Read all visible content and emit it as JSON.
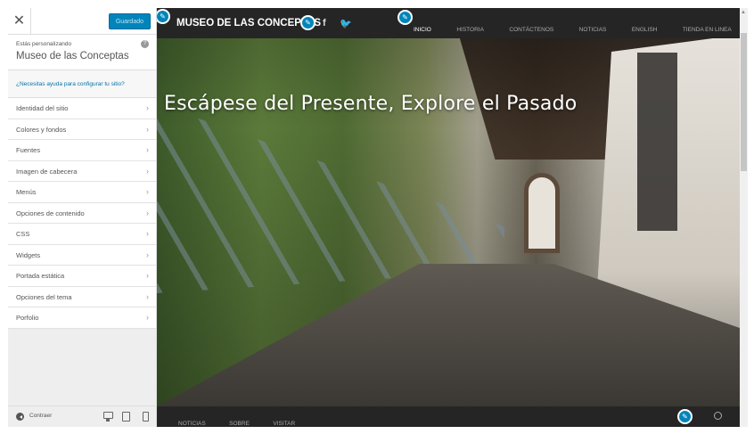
{
  "customizer": {
    "close_icon": "close-icon",
    "save_label": "Guardado",
    "editing_label": "Estás personalizando",
    "site_name": "Museo de las Conceptas",
    "help_link": "¿Necesitas ayuda para configurar tu sitio?",
    "panels": [
      {
        "label": "Identidad del sitio"
      },
      {
        "label": "Colores y fondos"
      },
      {
        "label": "Fuentes"
      },
      {
        "label": "Imagen de cabecera"
      },
      {
        "label": "Menús"
      },
      {
        "label": "Opciones de contenido"
      },
      {
        "label": "CSS"
      },
      {
        "label": "Widgets"
      },
      {
        "label": "Portada estática"
      },
      {
        "label": "Opciones del tema"
      },
      {
        "label": "Porfolio"
      }
    ],
    "collapse_label": "Contraer",
    "devices": [
      "desktop-icon",
      "tablet-icon",
      "mobile-icon"
    ]
  },
  "preview": {
    "site_title": "MUSEO DE LAS CONCEPTAS",
    "social": {
      "facebook": "f",
      "twitter": "🐦"
    },
    "nav": [
      {
        "label": "INICIO",
        "active": true
      },
      {
        "label": "HISTORIA"
      },
      {
        "label": "CONTÁCTENOS"
      },
      {
        "label": "NOTICIAS"
      },
      {
        "label": "ENGLISH"
      },
      {
        "label": "TIENDA EN LINEA"
      }
    ],
    "hero_title": "Escápese del Presente, Explore el Pasado",
    "footer_nav": [
      "NOTICIAS",
      "SOBRE",
      "VISITAR"
    ],
    "colors": {
      "accent": "#0085ba",
      "bar": "#252525"
    }
  }
}
